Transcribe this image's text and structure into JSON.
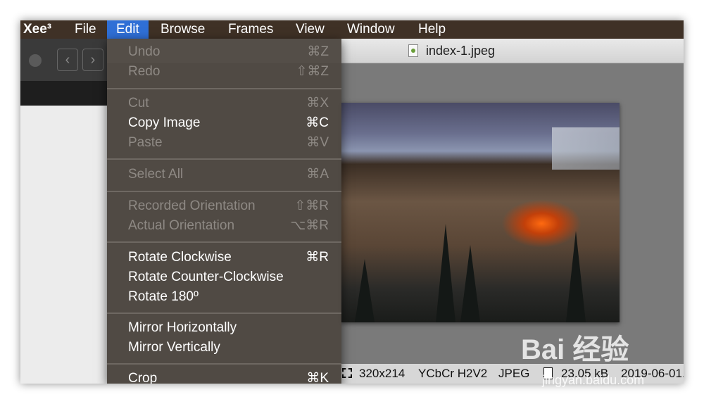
{
  "menubar": {
    "app": "Xee³",
    "items": [
      "File",
      "Edit",
      "Browse",
      "Frames",
      "View",
      "Window",
      "Help"
    ]
  },
  "window": {
    "title": "index-1.jpeg"
  },
  "edit_menu": {
    "undo": {
      "label": "Undo",
      "shortcut": "⌘Z"
    },
    "redo": {
      "label": "Redo",
      "shortcut": "⇧⌘Z"
    },
    "cut": {
      "label": "Cut",
      "shortcut": "⌘X"
    },
    "copy_image": {
      "label": "Copy Image",
      "shortcut": "⌘C"
    },
    "paste": {
      "label": "Paste",
      "shortcut": "⌘V"
    },
    "select_all": {
      "label": "Select All",
      "shortcut": "⌘A"
    },
    "recorded_orientation": {
      "label": "Recorded Orientation",
      "shortcut": "⇧⌘R"
    },
    "actual_orientation": {
      "label": "Actual Orientation",
      "shortcut": "⌥⌘R"
    },
    "rotate_cw": {
      "label": "Rotate Clockwise",
      "shortcut": "⌘R"
    },
    "rotate_ccw": {
      "label": "Rotate Counter-Clockwise"
    },
    "rotate_180": {
      "label": "Rotate 180º"
    },
    "mirror_h": {
      "label": "Mirror Horizontally"
    },
    "mirror_v": {
      "label": "Mirror Vertically"
    },
    "crop": {
      "label": "Crop",
      "shortcut": "⌘K"
    }
  },
  "statusbar": {
    "dimensions": "320x214",
    "color": "YCbCr H2V2",
    "format": "JPEG",
    "size": "23.05 kB",
    "date": "2019-06-01..."
  },
  "watermark": {
    "text": "Bai 经验",
    "url": "jingyan.baidu.com"
  },
  "colors": {
    "menubar": "#3f3126",
    "menu_highlight": "#2f6fd6",
    "menu_bg": "#4e4842"
  }
}
